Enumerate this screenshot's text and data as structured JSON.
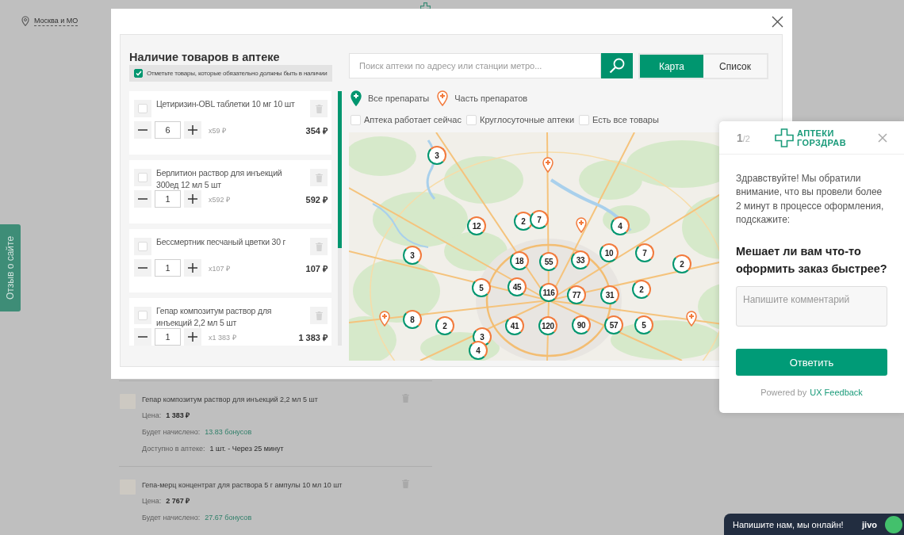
{
  "site_header": {
    "location": "Москва и МО"
  },
  "feedback_tab": {
    "label": "Отзыв о сайте"
  },
  "cart_items": [
    {
      "title": "Гепар композитум раствор для инъекций 2,2 мл 5 шт",
      "price_label": "Цена:",
      "price": "1 383 ₽",
      "bonus_label": "Будет начислено:",
      "bonus": "13.83 бонусов",
      "availability_label": "Доступно в аптеке:",
      "availability": "1 шт. - Через 25 минут"
    },
    {
      "title": "Гепа-мерц концентрат для раствора 5 г ампулы 10 мл 10 шт",
      "price_label": "Цена:",
      "price": "2 767 ₽",
      "bonus_label": "Будет начислено:",
      "bonus": "27.67 бонусов"
    }
  ],
  "modal": {
    "title": "Наличие товаров в аптеке",
    "must_have_notice": {
      "label": "Отметьте товары, которые обязательно должны быть в наличии",
      "checked": true
    },
    "products": [
      {
        "name": "Цетиризин-OBL таблетки 10 мг 10 шт",
        "checked": false,
        "quantity": "6",
        "unit_price": "x59 ₽",
        "total": "354 ₽"
      },
      {
        "name": "Берлитион раствор для инъекций 300ед 12 мл 5 шт",
        "checked": false,
        "quantity": "1",
        "unit_price": "x592 ₽",
        "total": "592 ₽"
      },
      {
        "name": "Бессмертник песчаный цветки 30 г",
        "checked": false,
        "quantity": "1",
        "unit_price": "x107 ₽",
        "total": "107 ₽"
      },
      {
        "name": "Гепар композитум раствор для инъекций 2,2 мл 5 шт",
        "checked": false,
        "quantity": "1",
        "unit_price": "x1 383 ₽",
        "total": "1 383 ₽"
      }
    ],
    "search": {
      "placeholder": "Поиск аптеки по адресу или станции метро..."
    },
    "view_tabs": [
      {
        "label": "Карта",
        "selected": true
      },
      {
        "label": "Список",
        "selected": false
      }
    ],
    "legend": [
      {
        "kind": "all",
        "label": "Все препараты"
      },
      {
        "kind": "partial",
        "label": "Часть препаратов"
      }
    ],
    "filters": [
      {
        "label": "Аптека работает сейчас",
        "checked": false
      },
      {
        "label": "Круглосуточные аптеки",
        "checked": false
      },
      {
        "label": "Есть все товары",
        "checked": false
      }
    ],
    "map": {
      "markers": [
        {
          "kind": "cluster",
          "count": "3"
        },
        {
          "kind": "pin"
        },
        {
          "kind": "cluster",
          "count": "12"
        },
        {
          "kind": "cluster",
          "count": "2"
        },
        {
          "kind": "cluster",
          "count": "7"
        },
        {
          "kind": "pin"
        },
        {
          "kind": "cluster",
          "count": "4"
        },
        {
          "kind": "cluster",
          "count": "3"
        },
        {
          "kind": "cluster",
          "count": "18"
        },
        {
          "kind": "cluster",
          "count": "55"
        },
        {
          "kind": "cluster",
          "count": "33"
        },
        {
          "kind": "cluster",
          "count": "10"
        },
        {
          "kind": "cluster",
          "count": "7"
        },
        {
          "kind": "cluster",
          "count": "2"
        },
        {
          "kind": "cluster",
          "count": "5"
        },
        {
          "kind": "cluster",
          "count": "45"
        },
        {
          "kind": "cluster",
          "count": "116"
        },
        {
          "kind": "cluster",
          "count": "77"
        },
        {
          "kind": "cluster",
          "count": "31"
        },
        {
          "kind": "cluster",
          "count": "2"
        },
        {
          "kind": "pin"
        },
        {
          "kind": "cluster",
          "count": "8"
        },
        {
          "kind": "cluster",
          "count": "2"
        },
        {
          "kind": "cluster",
          "count": "41"
        },
        {
          "kind": "cluster",
          "count": "120"
        },
        {
          "kind": "cluster",
          "count": "90"
        },
        {
          "kind": "cluster",
          "count": "57"
        },
        {
          "kind": "cluster",
          "count": "5"
        },
        {
          "kind": "pin"
        },
        {
          "kind": "cluster",
          "count": "3"
        },
        {
          "kind": "cluster",
          "count": "4"
        }
      ]
    }
  },
  "survey": {
    "counter": "**1**/2",
    "logo_text": "АПТЕКИ ГОРЗДРАВ",
    "message": "Здравствуйте! Мы обратили внимание, что вы провели более 2 минут в процессе оформления, подскажите:",
    "question": "Мешает ли вам что-то оформить заказ быстрее?",
    "comment": {
      "placeholder": "Напишите комментарий"
    },
    "submit": "Ответить",
    "powered_by": {
      "text": "Powered by",
      "link": "UX Feedback"
    }
  },
  "chat": {
    "label": "Напишите нам, мы онлайн!",
    "brand": "jivo"
  }
}
